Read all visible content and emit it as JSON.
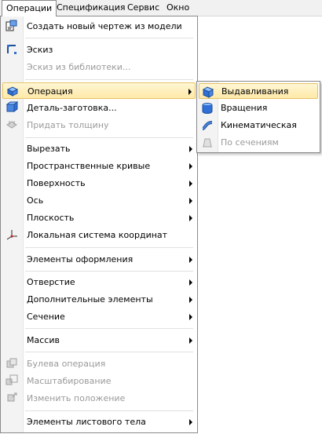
{
  "menubar": {
    "items": [
      {
        "label": "Операции",
        "active": true
      },
      {
        "label": "Спецификация",
        "active": false
      },
      {
        "label": "Сервис",
        "active": false
      },
      {
        "label": "Окно",
        "active": false
      }
    ]
  },
  "main_menu": {
    "items": [
      {
        "label": "Создать новый чертеж из модели",
        "icon": "drawing-from-model-icon",
        "enabled": true
      },
      {
        "label": "Эскиз",
        "icon": "sketch-icon",
        "enabled": true
      },
      {
        "label": "Эскиз из библиотеки...",
        "enabled": false
      },
      {
        "label": "Операция",
        "icon": "operation-icon",
        "enabled": true,
        "submenu": true,
        "highlighted": true
      },
      {
        "label": "Деталь-заготовка...",
        "icon": "workpiece-icon",
        "enabled": true
      },
      {
        "label": "Придать толщину",
        "icon": "thicken-icon",
        "enabled": false
      },
      {
        "label": "Вырезать",
        "enabled": true,
        "submenu": true
      },
      {
        "label": "Пространственные кривые",
        "enabled": true,
        "submenu": true
      },
      {
        "label": "Поверхность",
        "enabled": true,
        "submenu": true
      },
      {
        "label": "Ось",
        "enabled": true,
        "submenu": true
      },
      {
        "label": "Плоскость",
        "enabled": true,
        "submenu": true
      },
      {
        "label": "Локальная система координат",
        "icon": "local-coord-icon",
        "enabled": true
      },
      {
        "label": "Элементы оформления",
        "enabled": true,
        "submenu": true
      },
      {
        "label": "Отверстие",
        "enabled": true,
        "submenu": true
      },
      {
        "label": "Дополнительные элементы",
        "enabled": true,
        "submenu": true
      },
      {
        "label": "Сечение",
        "enabled": true,
        "submenu": true
      },
      {
        "label": "Массив",
        "enabled": true,
        "submenu": true
      },
      {
        "label": "Булева операция",
        "icon": "boolean-icon",
        "enabled": false
      },
      {
        "label": "Масштабирование",
        "icon": "scale-icon",
        "enabled": false
      },
      {
        "label": "Изменить положение",
        "icon": "move-icon",
        "enabled": false
      },
      {
        "label": "Элементы листового тела",
        "enabled": true,
        "submenu": true
      }
    ]
  },
  "sub_menu": {
    "items": [
      {
        "label": "Выдавливания",
        "icon": "extrude-icon",
        "enabled": true,
        "highlighted": true
      },
      {
        "label": "Вращения",
        "icon": "revolve-icon",
        "enabled": true
      },
      {
        "label": "Кинематическая",
        "icon": "sweep-icon",
        "enabled": true
      },
      {
        "label": "По сечениям",
        "icon": "loft-icon",
        "enabled": false
      }
    ]
  },
  "colors": {
    "highlight": "#ffe9a8",
    "highlight_border": "#e5c365",
    "icon_blue": "#2f6fd6",
    "disabled_text": "#9a9a9a"
  }
}
